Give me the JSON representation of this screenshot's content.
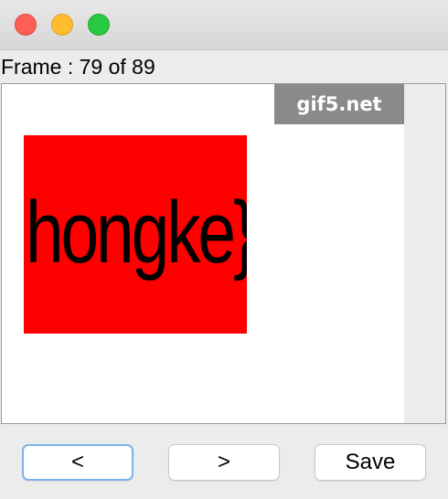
{
  "window": {
    "traffic_lights": {
      "close_color": "#fe5f57",
      "minimize_color": "#febc2e",
      "maximize_color": "#28c840"
    }
  },
  "frame_info": {
    "label": "Frame : 79 of 89",
    "current": 79,
    "total": 89
  },
  "viewer": {
    "watermark": "gif5.net",
    "image_text": "hongke}",
    "image_background": "#ff0000"
  },
  "buttons": {
    "prev_label": "<",
    "next_label": ">",
    "save_label": "Save"
  }
}
